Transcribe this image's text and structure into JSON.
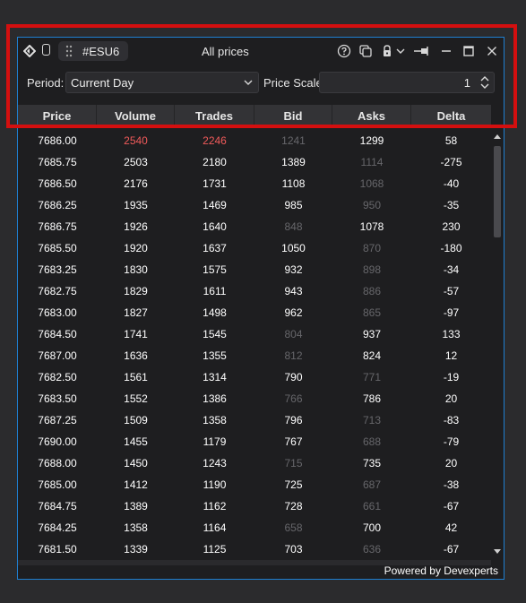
{
  "window": {
    "symbol": "#ESU6",
    "title": "All prices"
  },
  "filters": {
    "period_label": "Period:",
    "period_value": "Current Day",
    "price_scale_label": "Price Scale:",
    "price_scale_value": "1"
  },
  "columns": [
    "Price",
    "Volume",
    "Trades",
    "Bid",
    "Asks",
    "Delta"
  ],
  "rows": [
    {
      "price": "7686.00",
      "volume": "2540",
      "trades": "2246",
      "bid": "1241",
      "asks": "1299",
      "delta": "58",
      "vol_hi": true,
      "trd_hi": true,
      "bid_dim": true,
      "ask_dim": false
    },
    {
      "price": "7685.75",
      "volume": "2503",
      "trades": "2180",
      "bid": "1389",
      "asks": "1114",
      "delta": "-275",
      "bid_dim": false,
      "ask_dim": true
    },
    {
      "price": "7686.50",
      "volume": "2176",
      "trades": "1731",
      "bid": "1108",
      "asks": "1068",
      "delta": "-40",
      "bid_dim": false,
      "ask_dim": true
    },
    {
      "price": "7686.25",
      "volume": "1935",
      "trades": "1469",
      "bid": "985",
      "asks": "950",
      "delta": "-35",
      "bid_dim": false,
      "ask_dim": true
    },
    {
      "price": "7686.75",
      "volume": "1926",
      "trades": "1640",
      "bid": "848",
      "asks": "1078",
      "delta": "230",
      "bid_dim": true,
      "ask_dim": false
    },
    {
      "price": "7685.50",
      "volume": "1920",
      "trades": "1637",
      "bid": "1050",
      "asks": "870",
      "delta": "-180",
      "bid_dim": false,
      "ask_dim": true
    },
    {
      "price": "7683.25",
      "volume": "1830",
      "trades": "1575",
      "bid": "932",
      "asks": "898",
      "delta": "-34",
      "bid_dim": false,
      "ask_dim": true
    },
    {
      "price": "7682.75",
      "volume": "1829",
      "trades": "1611",
      "bid": "943",
      "asks": "886",
      "delta": "-57",
      "bid_dim": false,
      "ask_dim": true
    },
    {
      "price": "7683.00",
      "volume": "1827",
      "trades": "1498",
      "bid": "962",
      "asks": "865",
      "delta": "-97",
      "bid_dim": false,
      "ask_dim": true
    },
    {
      "price": "7684.50",
      "volume": "1741",
      "trades": "1545",
      "bid": "804",
      "asks": "937",
      "delta": "133",
      "bid_dim": true,
      "ask_dim": false
    },
    {
      "price": "7687.00",
      "volume": "1636",
      "trades": "1355",
      "bid": "812",
      "asks": "824",
      "delta": "12",
      "bid_dim": true,
      "ask_dim": false
    },
    {
      "price": "7682.50",
      "volume": "1561",
      "trades": "1314",
      "bid": "790",
      "asks": "771",
      "delta": "-19",
      "bid_dim": false,
      "ask_dim": true
    },
    {
      "price": "7683.50",
      "volume": "1552",
      "trades": "1386",
      "bid": "766",
      "asks": "786",
      "delta": "20",
      "bid_dim": true,
      "ask_dim": false
    },
    {
      "price": "7687.25",
      "volume": "1509",
      "trades": "1358",
      "bid": "796",
      "asks": "713",
      "delta": "-83",
      "bid_dim": false,
      "ask_dim": true
    },
    {
      "price": "7690.00",
      "volume": "1455",
      "trades": "1179",
      "bid": "767",
      "asks": "688",
      "delta": "-79",
      "bid_dim": false,
      "ask_dim": true
    },
    {
      "price": "7688.00",
      "volume": "1450",
      "trades": "1243",
      "bid": "715",
      "asks": "735",
      "delta": "20",
      "bid_dim": true,
      "ask_dim": false
    },
    {
      "price": "7685.00",
      "volume": "1412",
      "trades": "1190",
      "bid": "725",
      "asks": "687",
      "delta": "-38",
      "bid_dim": false,
      "ask_dim": true
    },
    {
      "price": "7684.75",
      "volume": "1389",
      "trades": "1162",
      "bid": "728",
      "asks": "661",
      "delta": "-67",
      "bid_dim": false,
      "ask_dim": true
    },
    {
      "price": "7684.25",
      "volume": "1358",
      "trades": "1164",
      "bid": "658",
      "asks": "700",
      "delta": "42",
      "bid_dim": true,
      "ask_dim": false
    },
    {
      "price": "7681.50",
      "volume": "1339",
      "trades": "1125",
      "bid": "703",
      "asks": "636",
      "delta": "-67",
      "bid_dim": false,
      "ask_dim": true
    }
  ],
  "footer": {
    "powered_by": "Powered by Devexperts"
  },
  "colors": {
    "accent_border": "#1f7fd0",
    "highlight": "#d40f0f",
    "high_value": "#f05a5a",
    "dim_value": "#66666a"
  },
  "icons": [
    "logo-icon",
    "document-icon",
    "drag-grip-icon",
    "help-icon",
    "copy-icon",
    "lock-icon",
    "chevron-down-icon",
    "pin-icon",
    "minimize-icon",
    "maximize-icon",
    "close-icon"
  ]
}
